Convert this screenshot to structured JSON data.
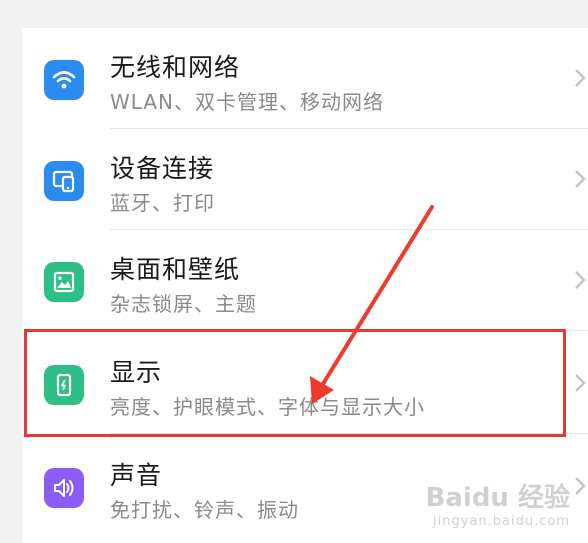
{
  "settings": {
    "items": [
      {
        "title": "无线和网络",
        "subtitle": "WLAN、双卡管理、移动网络",
        "icon": "wifi-icon",
        "icon_color": "#2b8cf0"
      },
      {
        "title": "设备连接",
        "subtitle": "蓝牙、打印",
        "icon": "device-connection-icon",
        "icon_color": "#2b8cf0"
      },
      {
        "title": "桌面和壁纸",
        "subtitle": "杂志锁屏、主题",
        "icon": "wallpaper-icon",
        "icon_color": "#2dbf85"
      },
      {
        "title": "显示",
        "subtitle": "亮度、护眼模式、字体与显示大小",
        "icon": "display-icon",
        "icon_color": "#2dbf85"
      },
      {
        "title": "声音",
        "subtitle": "免打扰、铃声、振动",
        "icon": "sound-icon",
        "icon_color": "#8b5cf6"
      }
    ]
  },
  "annotation": {
    "highlight_color": "#e53935",
    "highlighted_item": "显示"
  },
  "watermark": {
    "main": "Baidu 经验",
    "sub": "jingyan.baidu.com"
  }
}
